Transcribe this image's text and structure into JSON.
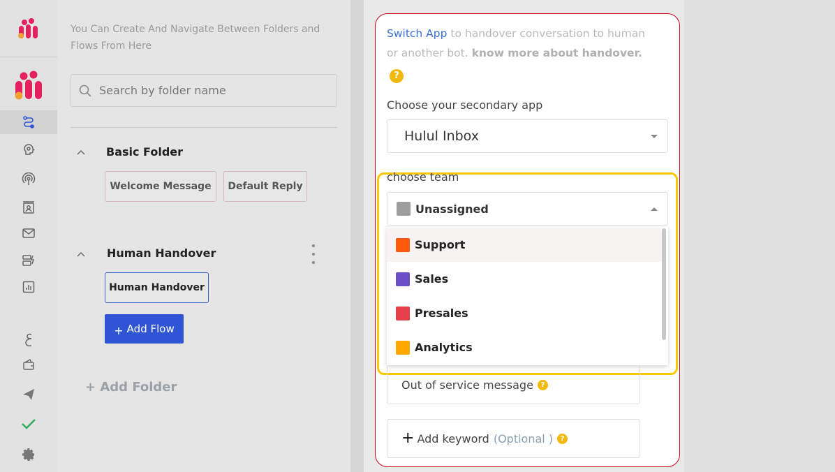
{
  "folders_panel": {
    "hint": "You Can Create And Navigate Between Folders and Flows From Here",
    "search_placeholder": "Search by folder name",
    "folders": [
      {
        "name": "Basic Folder",
        "flows": [
          "Welcome Message",
          "Default Reply"
        ]
      },
      {
        "name": "Human Handover",
        "flows": [
          "Human Handover"
        ]
      }
    ],
    "add_flow_label": "Add Flow",
    "add_folder_label": "+ Add Folder"
  },
  "config": {
    "intro_link": "Switch App",
    "intro_text": " to handover conversation to human or another bot. ",
    "intro_bold": "know more about handover.",
    "secondary_app_label": "Choose your secondary app",
    "secondary_app_value": "Hulul Inbox",
    "team_label": "choose team",
    "team_selected": {
      "name": "Unassigned",
      "color": "#9e9e9e"
    },
    "team_options": [
      {
        "name": "Support",
        "color": "#ff5a0a"
      },
      {
        "name": "Sales",
        "color": "#6a4fc7"
      },
      {
        "name": "Presales",
        "color": "#e63e4b"
      },
      {
        "name": "Analytics",
        "color": "#ffa800"
      }
    ],
    "out_of_service_label": "Out of service message",
    "add_keyword_label": "Add keyword",
    "add_keyword_optional": "(Optional )"
  },
  "colors": {
    "brand": "#e5205f",
    "primary_button": "#2f55d4",
    "highlight": "#f5c800",
    "card_border": "#d0021b"
  },
  "icons": [
    "brand-logo-icon",
    "flows-icon",
    "bot-brain-icon",
    "broadcast-icon",
    "contacts-icon",
    "mail-icon",
    "templates-icon",
    "analytics-icon",
    "language-icon",
    "wallet-icon",
    "send-icon",
    "check-icon",
    "settings-icon"
  ]
}
